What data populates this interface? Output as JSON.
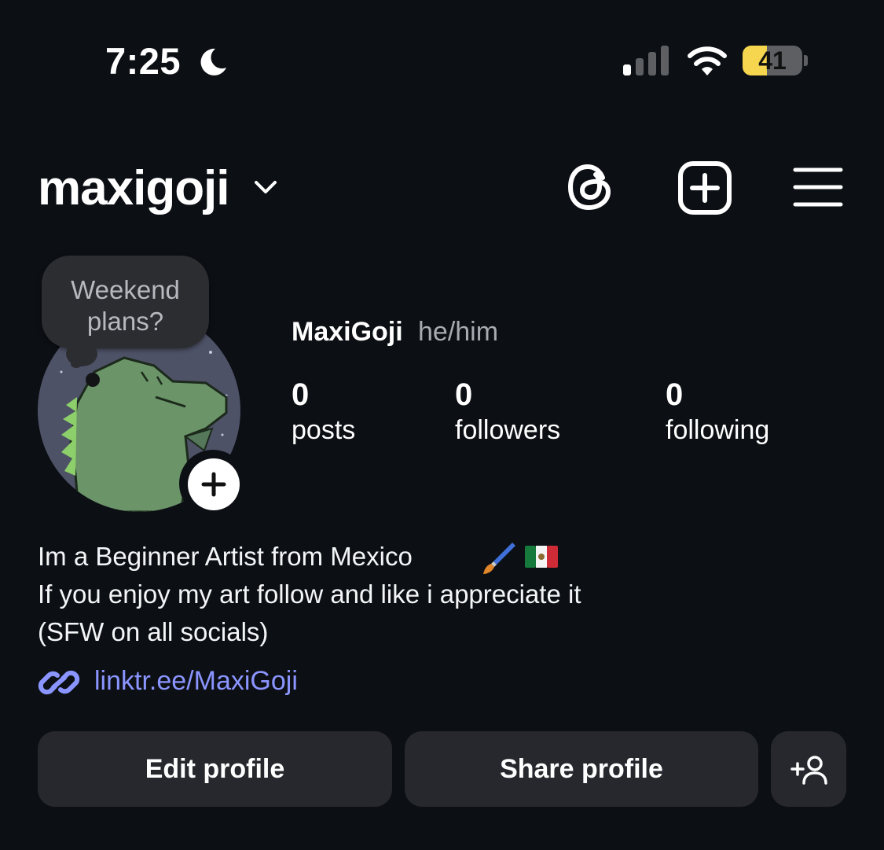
{
  "status_bar": {
    "time": "7:25",
    "battery_level": "41",
    "battery_fraction": 0.41,
    "icons": [
      "moon-icon",
      "signal-icon",
      "wifi-icon",
      "battery-icon"
    ]
  },
  "header": {
    "username": "maxigoji",
    "icons": [
      "chevron-down-icon",
      "threads-icon",
      "new-post-icon",
      "menu-icon"
    ]
  },
  "profile": {
    "note": "Weekend\nplans?",
    "display_name": "MaxiGoji",
    "pronouns": "he/him",
    "stats": [
      {
        "number": "0",
        "label": "posts"
      },
      {
        "number": "0",
        "label": "followers"
      },
      {
        "number": "0",
        "label": "following"
      }
    ],
    "bio": {
      "line1": "Im a Beginner Artist from Mexico",
      "line1_emoji": [
        "paintbrush",
        "mexico-flag"
      ],
      "line2": "If you enjoy my art follow and like i appreciate it",
      "line3": "(SFW on all socials)"
    },
    "link": "linktr.ee/MaxiGoji"
  },
  "buttons": {
    "edit_profile": "Edit profile",
    "share_profile": "Share profile",
    "add_person_icon": "add-person-icon"
  },
  "colors": {
    "background": "#0c0f14",
    "button_bg": "#26282d",
    "link": "#8b95ff",
    "battery_yellow": "#f5d64e"
  }
}
